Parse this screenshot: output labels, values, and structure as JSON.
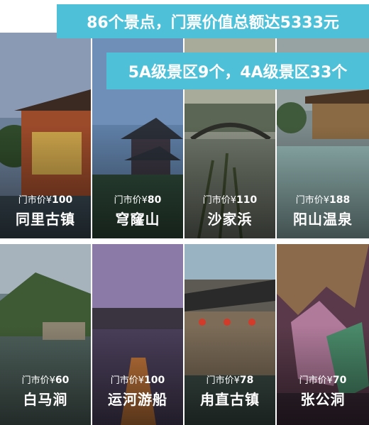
{
  "banner_top": "86个景点，门票价值总额达5333元",
  "banner_second": "5A级景区9个，4A级景区33个",
  "price_prefix": "门市价¥",
  "spots": [
    {
      "name": "同里古镇",
      "price": "100"
    },
    {
      "name": "穹窿山",
      "price": "80"
    },
    {
      "name": "沙家浜",
      "price": "110"
    },
    {
      "name": "阳山温泉",
      "price": "188"
    },
    {
      "name": "白马涧",
      "price": "60"
    },
    {
      "name": "运河游船",
      "price": "100"
    },
    {
      "name": "甪直古镇",
      "price": "78"
    },
    {
      "name": "张公洞",
      "price": "70"
    }
  ],
  "colors": {
    "banner": "#4ec1d9",
    "text": "#ffffff"
  }
}
